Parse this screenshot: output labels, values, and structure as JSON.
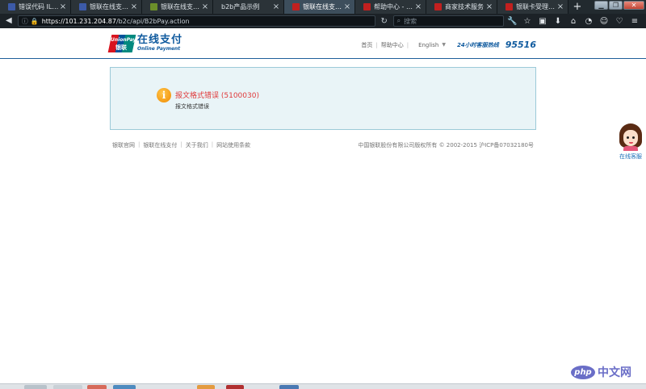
{
  "browser": {
    "tabs": [
      {
        "title": "错误代码 ILLEG...",
        "fav": "#3c5aa8",
        "active": false
      },
      {
        "title": "银联在线支付接...",
        "fav": "#3c5aa8",
        "active": false
      },
      {
        "title": "银联在线支付商...",
        "fav": "#6c8f2a",
        "active": false
      },
      {
        "title": "b2b产品示例",
        "fav": "",
        "active": false
      },
      {
        "title": "银联在线支付—...",
        "fav": "#c2201f",
        "active": true
      },
      {
        "title": "帮助中心 - 银联...",
        "fav": "#c2201f",
        "active": false
      },
      {
        "title": "商家技术服务",
        "fav": "#c2201f",
        "active": false
      },
      {
        "title": "银联卡受理终端...",
        "fav": "#c2201f",
        "active": false
      }
    ],
    "new_tab": "+",
    "url_host": "https://101.231.204.87",
    "url_path": "/b2c/api/B2bPay.action",
    "search_placeholder": "搜索"
  },
  "header": {
    "logo_cn": "在线支付",
    "logo_en": "Online Payment",
    "logo_badge_en": "UnionPay",
    "logo_badge_cn": "银联",
    "nav_home": "首页",
    "nav_help": "帮助中心",
    "nav_lang": "English",
    "hotline_label": "24小时客服热线",
    "hotline_number": "95516"
  },
  "error": {
    "title": "报文格式错误 (5100030)",
    "desc": "报文格式错误"
  },
  "footer": {
    "links": [
      "银联官网",
      "银联在线支付",
      "关于我们",
      "网站使用条款"
    ],
    "copyright": "中国银联股份有限公司版权所有 © 2002-2015  沪ICP备07032180号"
  },
  "kefu": {
    "label": "在线客服"
  },
  "watermark": {
    "logo": "php",
    "text": "中文网"
  },
  "colors": {
    "brand_blue": "#0f5a9e",
    "error_red": "#e0393a",
    "box_bg": "#e9f4f7"
  }
}
